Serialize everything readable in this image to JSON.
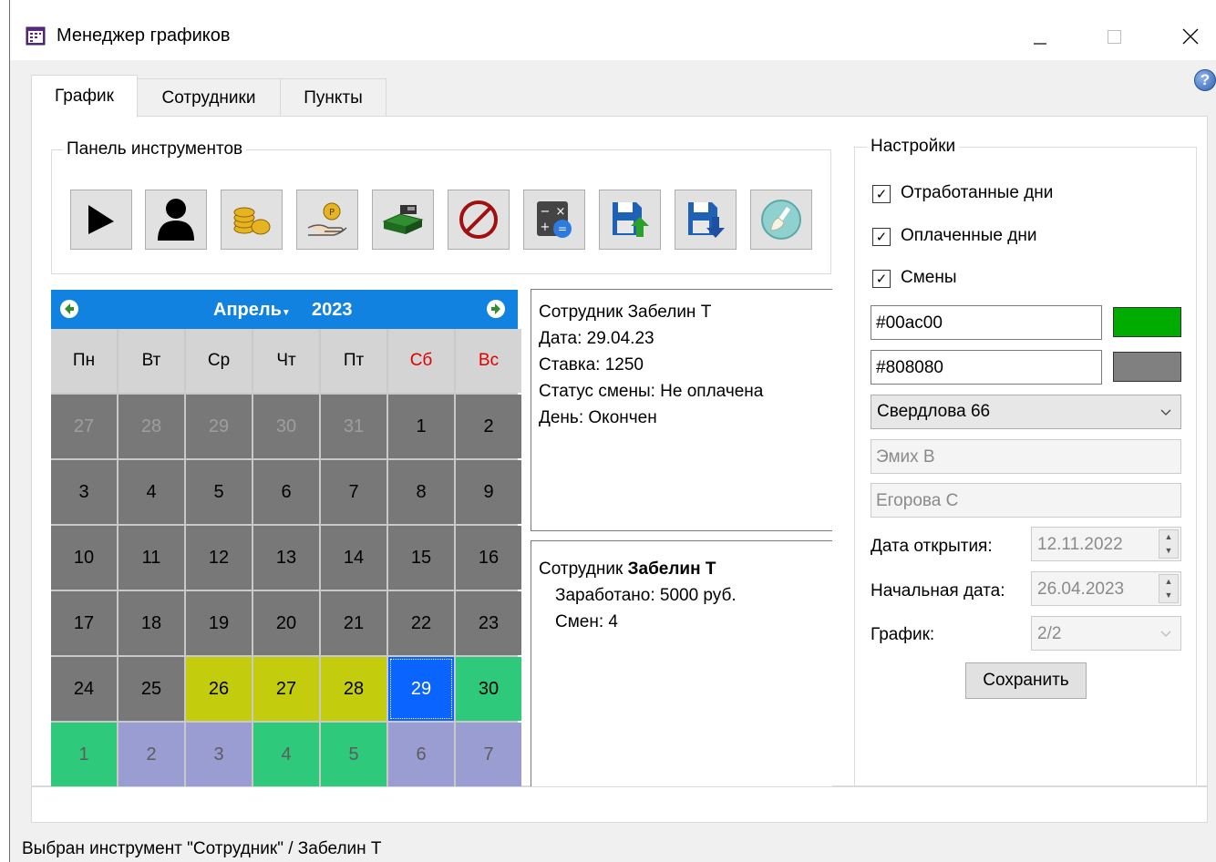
{
  "window": {
    "title": "Менеджер графиков"
  },
  "tabs": [
    {
      "label": "График",
      "active": true
    },
    {
      "label": "Сотрудники",
      "active": false
    },
    {
      "label": "Пункты",
      "active": false
    }
  ],
  "toolbar": {
    "title": "Панель инструментов",
    "tools": [
      "pointer-icon",
      "person-icon",
      "coins-icon",
      "hand-coin-icon",
      "cash-register-icon",
      "forbidden-icon",
      "calculator-icon",
      "save-upload-icon",
      "save-download-icon",
      "cleaner-icon"
    ]
  },
  "calendar": {
    "month": "Апрель",
    "year": "2023",
    "weekdays": [
      "Пн",
      "Вт",
      "Ср",
      "Чт",
      "Пт",
      "Сб",
      "Вс"
    ],
    "weekend_color": "#e00000",
    "days": [
      {
        "d": "27",
        "bg": "#787878",
        "fg": "#9e9e9e"
      },
      {
        "d": "28",
        "bg": "#787878",
        "fg": "#9e9e9e"
      },
      {
        "d": "29",
        "bg": "#787878",
        "fg": "#9e9e9e"
      },
      {
        "d": "30",
        "bg": "#787878",
        "fg": "#9e9e9e"
      },
      {
        "d": "31",
        "bg": "#787878",
        "fg": "#9e9e9e"
      },
      {
        "d": "1",
        "bg": "#787878",
        "fg": "#000"
      },
      {
        "d": "2",
        "bg": "#787878",
        "fg": "#000"
      },
      {
        "d": "3",
        "bg": "#787878",
        "fg": "#000"
      },
      {
        "d": "4",
        "bg": "#787878",
        "fg": "#000"
      },
      {
        "d": "5",
        "bg": "#787878",
        "fg": "#000"
      },
      {
        "d": "6",
        "bg": "#787878",
        "fg": "#000"
      },
      {
        "d": "7",
        "bg": "#787878",
        "fg": "#000"
      },
      {
        "d": "8",
        "bg": "#787878",
        "fg": "#000"
      },
      {
        "d": "9",
        "bg": "#787878",
        "fg": "#000"
      },
      {
        "d": "10",
        "bg": "#787878",
        "fg": "#000"
      },
      {
        "d": "11",
        "bg": "#787878",
        "fg": "#000"
      },
      {
        "d": "12",
        "bg": "#787878",
        "fg": "#000"
      },
      {
        "d": "13",
        "bg": "#787878",
        "fg": "#000"
      },
      {
        "d": "14",
        "bg": "#787878",
        "fg": "#000"
      },
      {
        "d": "15",
        "bg": "#787878",
        "fg": "#000"
      },
      {
        "d": "16",
        "bg": "#787878",
        "fg": "#000"
      },
      {
        "d": "17",
        "bg": "#787878",
        "fg": "#000"
      },
      {
        "d": "18",
        "bg": "#787878",
        "fg": "#000"
      },
      {
        "d": "19",
        "bg": "#787878",
        "fg": "#000"
      },
      {
        "d": "20",
        "bg": "#787878",
        "fg": "#000"
      },
      {
        "d": "21",
        "bg": "#787878",
        "fg": "#000"
      },
      {
        "d": "22",
        "bg": "#787878",
        "fg": "#000"
      },
      {
        "d": "23",
        "bg": "#787878",
        "fg": "#000"
      },
      {
        "d": "24",
        "bg": "#787878",
        "fg": "#000"
      },
      {
        "d": "25",
        "bg": "#787878",
        "fg": "#000"
      },
      {
        "d": "26",
        "bg": "#c4cc0e",
        "fg": "#000"
      },
      {
        "d": "27",
        "bg": "#c4cc0e",
        "fg": "#000"
      },
      {
        "d": "28",
        "bg": "#c4cc0e",
        "fg": "#000"
      },
      {
        "d": "29",
        "bg": "#0a64ff",
        "fg": "#fff",
        "selected": true
      },
      {
        "d": "30",
        "bg": "#2ec97a",
        "fg": "#000"
      },
      {
        "d": "1",
        "bg": "#2ec97a",
        "fg": "#5c5c5c"
      },
      {
        "d": "2",
        "bg": "#9a9dd2",
        "fg": "#5c5c5c"
      },
      {
        "d": "3",
        "bg": "#9a9dd2",
        "fg": "#5c5c5c"
      },
      {
        "d": "4",
        "bg": "#2ec97a",
        "fg": "#5c5c5c"
      },
      {
        "d": "5",
        "bg": "#2ec97a",
        "fg": "#5c5c5c"
      },
      {
        "d": "6",
        "bg": "#9a9dd2",
        "fg": "#5c5c5c"
      },
      {
        "d": "7",
        "bg": "#9a9dd2",
        "fg": "#5c5c5c"
      }
    ]
  },
  "day_info": {
    "lines": [
      "Сотрудник Забелин Т",
      "Дата: 29.04.23",
      "Ставка: 1250",
      "Статус смены: Не оплачена",
      "День: Окончен"
    ]
  },
  "employee_info": {
    "prefix": "Сотрудник ",
    "name": "Забелин Т",
    "earned": "Заработано: 5000 руб.",
    "shifts": "Смен: 4"
  },
  "settings": {
    "title": "Настройки",
    "checkboxes": [
      {
        "label": "Отработанные дни",
        "checked": true
      },
      {
        "label": "Оплаченные дни",
        "checked": true
      },
      {
        "label": "Смены",
        "checked": true
      }
    ],
    "color1": "#00ac00",
    "color2": "#808080",
    "location": "Свердлова 66",
    "employee1": "Эмих В",
    "employee2": "Егорова С",
    "open_date_label": "Дата открытия:",
    "open_date": "12.11.2022",
    "start_date_label": "Начальная дата:",
    "start_date": "26.04.2023",
    "schedule_label": "График:",
    "schedule": "2/2",
    "save_label": "Сохранить"
  },
  "status_bar": "Выбран инструмент \"Сотрудник\" / Забелин Т"
}
